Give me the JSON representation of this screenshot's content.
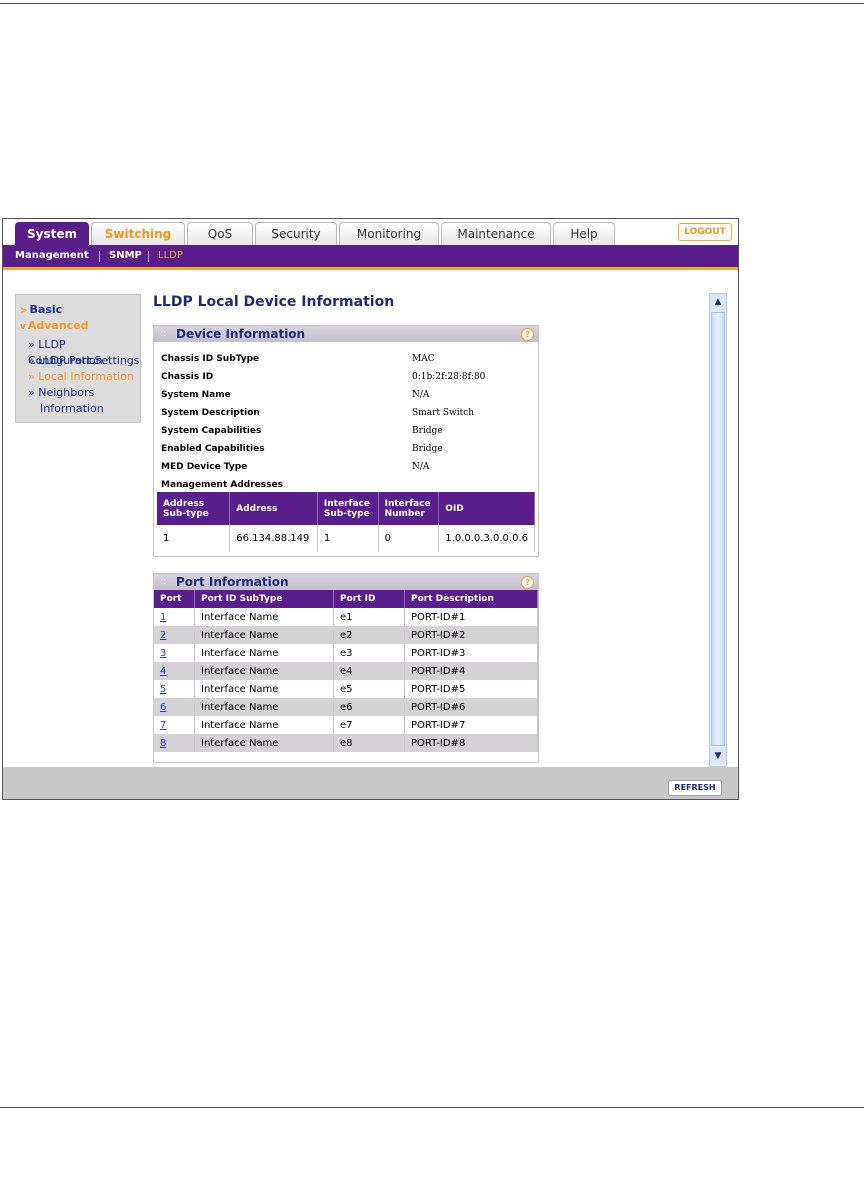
{
  "tabs": [
    {
      "label": "System"
    },
    {
      "label": "Switching"
    },
    {
      "label": "QoS"
    },
    {
      "label": "Security"
    },
    {
      "label": "Monitoring"
    },
    {
      "label": "Maintenance"
    },
    {
      "label": "Help"
    }
  ],
  "logout_label": "LOGOUT",
  "subnav": [
    {
      "label": "Management"
    },
    {
      "label": "SNMP"
    },
    {
      "label": "LLDP"
    }
  ],
  "sidebar": {
    "basic": "Basic",
    "advanced": "Advanced",
    "items": [
      {
        "label": "» LLDP Configuration"
      },
      {
        "label": "» LLDP Port Settings"
      },
      {
        "label": "» Local Information"
      },
      {
        "label": "» Neighbors"
      },
      {
        "label": "Information"
      }
    ]
  },
  "page_title": "LLDP Local Device Information",
  "device_info": {
    "title": "Device Information",
    "help": "?",
    "fields": [
      {
        "label": "Chassis ID SubType",
        "value": "MAC"
      },
      {
        "label": "Chassis ID",
        "value": "0:1b:2f:28:8f:80"
      },
      {
        "label": "System Name",
        "value": "N/A"
      },
      {
        "label": "System Description",
        "value": "Smart Switch"
      },
      {
        "label": "System Capabilities",
        "value": "Bridge"
      },
      {
        "label": "Enabled Capabilities",
        "value": "Bridge"
      },
      {
        "label": "MED Device Type",
        "value": "N/A"
      }
    ],
    "mgmt_label": "Management Addresses",
    "mgmt_headers": [
      "Address Sub-type",
      "Address",
      "Interface Sub-type",
      "Interface Number",
      "OID"
    ],
    "mgmt_row": [
      "1",
      "66.134.88.149",
      "1",
      "0",
      "1.0.0.0.3.0.0.0.6"
    ]
  },
  "port_info": {
    "title": "Port Information",
    "help": "?",
    "headers": [
      "Port",
      "Port ID SubType",
      "Port ID",
      "Port Description"
    ],
    "rows": [
      [
        "1",
        "Interface Name",
        "e1",
        "PORT-ID#1"
      ],
      [
        "2",
        "Interface Name",
        "e2",
        "PORT-ID#2"
      ],
      [
        "3",
        "Interface Name",
        "e3",
        "PORT-ID#3"
      ],
      [
        "4",
        "Interface Name",
        "e4",
        "PORT-ID#4"
      ],
      [
        "5",
        "Interface Name",
        "e5",
        "PORT-ID#5"
      ],
      [
        "6",
        "Interface Name",
        "e6",
        "PORT-ID#6"
      ],
      [
        "7",
        "Interface Name",
        "e7",
        "PORT-ID#7"
      ],
      [
        "8",
        "Interface Name",
        "e8",
        "PORT-ID#8"
      ]
    ]
  },
  "refresh_label": "REFRESH",
  "colors": {
    "brand_purple": "#5a1e8c",
    "accent_orange": "#f7941d",
    "title_blue": "#1c2b7a"
  },
  "icons": {
    "scroll_up": "chevron-up-icon",
    "scroll_down": "chevron-down-icon",
    "help": "help-icon"
  }
}
